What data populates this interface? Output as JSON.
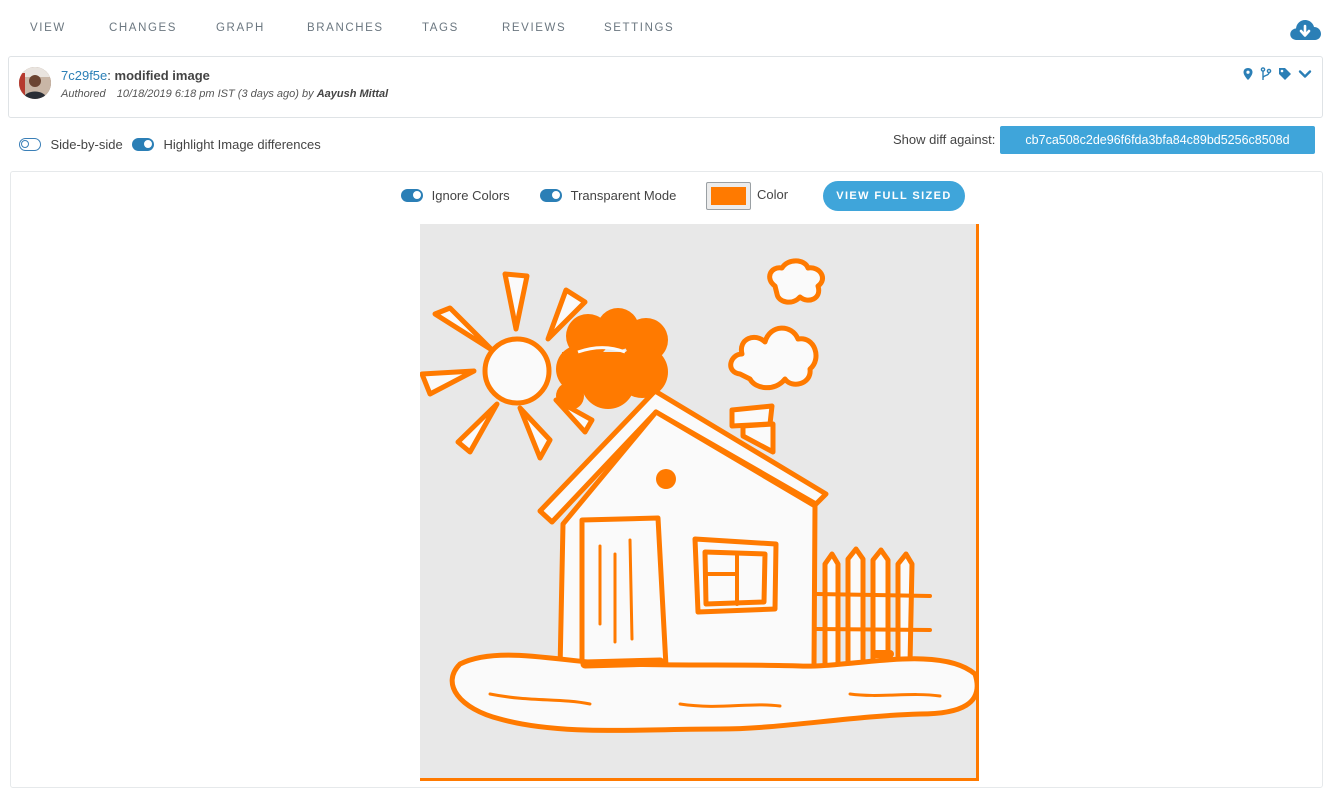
{
  "nav": {
    "items": [
      "VIEW",
      "CHANGES",
      "GRAPH",
      "BRANCHES",
      "TAGS",
      "REVIEWS",
      "SETTINGS"
    ]
  },
  "commit": {
    "hash": "7c29f5e",
    "separator": ":",
    "message": "modified image",
    "authored_label": "Authored",
    "date": "10/18/2019 6:18 pm IST (3 days ago)",
    "by_label": "by",
    "author": "Aayush Mittal"
  },
  "options": {
    "side_by_side": {
      "label": "Side-by-side",
      "enabled": false
    },
    "highlight": {
      "label": "Highlight Image differences",
      "enabled": true
    }
  },
  "diff": {
    "label": "Show diff against:",
    "against_hash": "cb7ca508c2de96f6fda3bfa84c89bd5256c8508d"
  },
  "viewer": {
    "ignore_colors": {
      "label": "Ignore Colors",
      "enabled": true
    },
    "transparent_mode": {
      "label": "Transparent Mode",
      "enabled": true
    },
    "color_label": "Color",
    "highlight_color": "#ff7a00",
    "full_size_button": "VIEW FULL SIZED"
  },
  "colors": {
    "accent": "#2b7fb6",
    "button": "#3fa5da",
    "highlight": "#ff7a00"
  }
}
